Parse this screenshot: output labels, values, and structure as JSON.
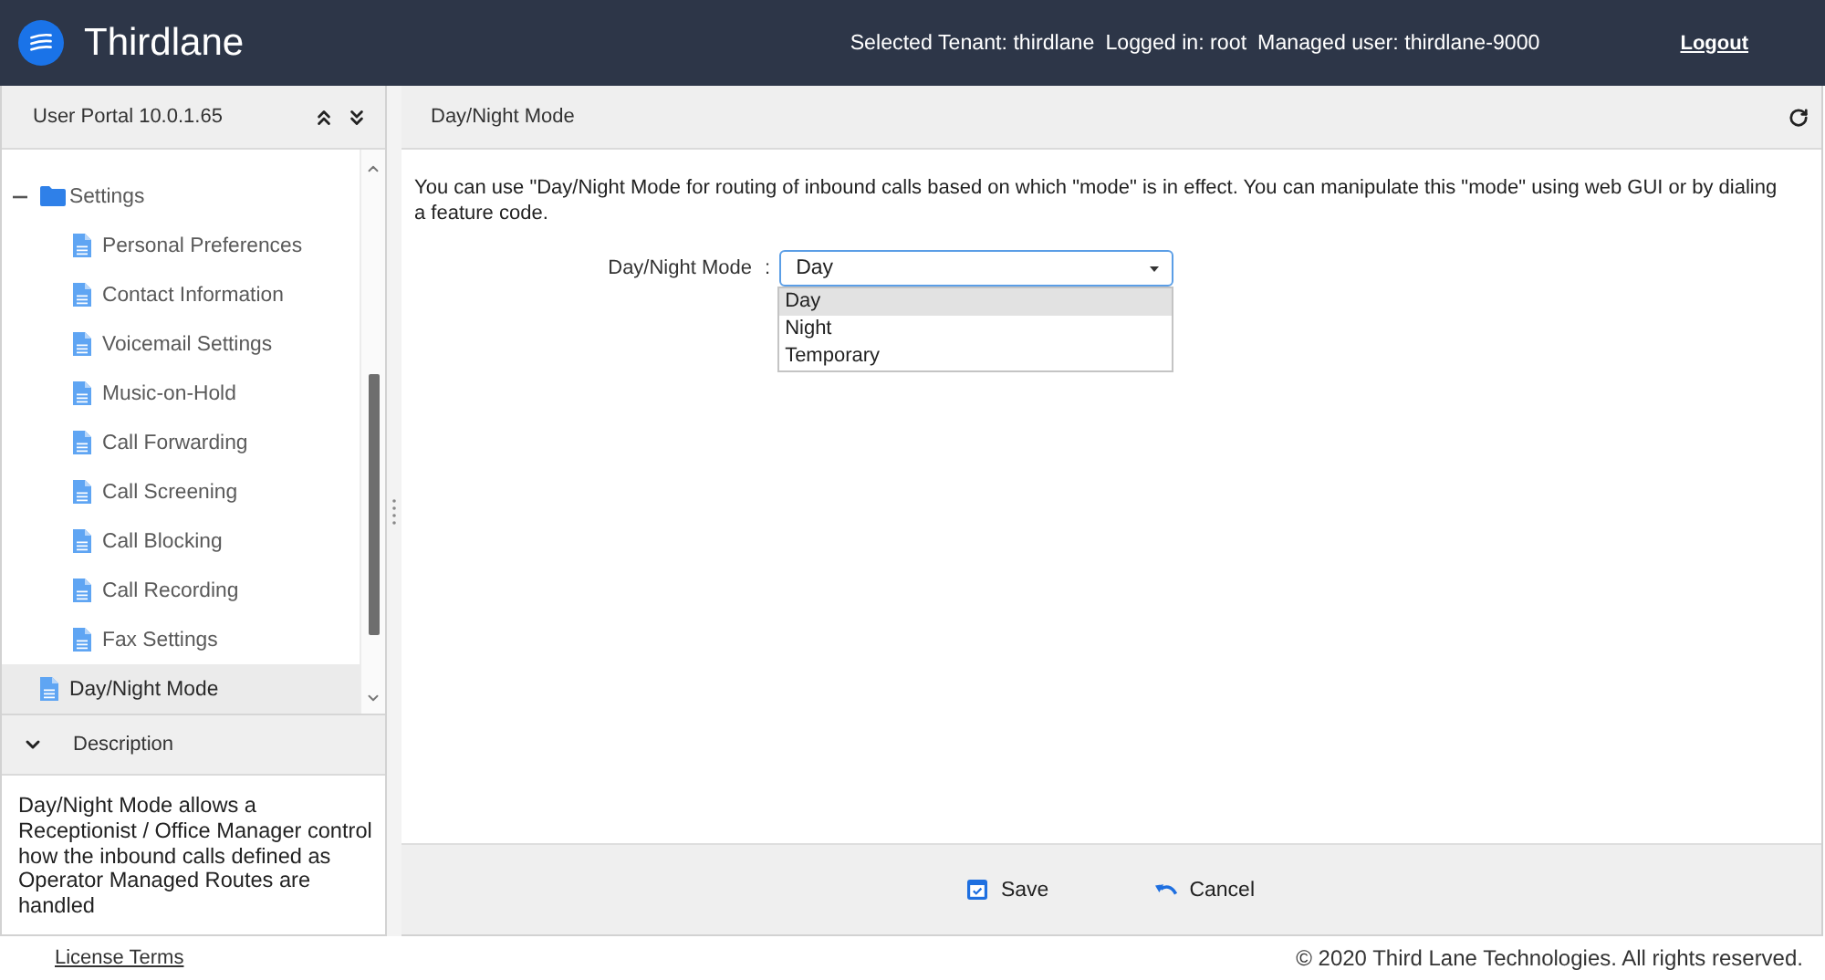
{
  "header": {
    "brand": "Thirdlane",
    "session": [
      "Selected Tenant: thirdlane",
      "Logged in: root",
      "Managed user: thirdlane-9000"
    ],
    "logout": "Logout"
  },
  "sidebar": {
    "title": "User Portal 10.0.1.65",
    "tree": [
      {
        "label": "Settings",
        "kind": "folder",
        "expanded": true,
        "selected": false,
        "children": [
          {
            "label": "Personal Preferences",
            "kind": "document",
            "selected": false
          },
          {
            "label": "Contact Information",
            "kind": "document",
            "selected": false
          },
          {
            "label": "Voicemail Settings",
            "kind": "document",
            "selected": false
          },
          {
            "label": "Music-on-Hold",
            "kind": "document",
            "selected": false
          },
          {
            "label": "Call Forwarding",
            "kind": "document",
            "selected": false
          },
          {
            "label": "Call Screening",
            "kind": "document",
            "selected": false
          },
          {
            "label": "Call Blocking",
            "kind": "document",
            "selected": false
          },
          {
            "label": "Call Recording",
            "kind": "document",
            "selected": false
          },
          {
            "label": "Fax Settings",
            "kind": "document",
            "selected": false
          }
        ]
      },
      {
        "label": "Day/Night Mode",
        "kind": "document",
        "selected": true
      }
    ]
  },
  "description": {
    "title": "Description",
    "expanded": true,
    "text": "Day/Night Mode allows a Receptionist / Office Manager control how the inbound calls defined as Operator Managed Routes are handled"
  },
  "content": {
    "title": "Day/Night Mode",
    "intro": "You can use \"Day/Night Mode for routing of inbound calls based on which \"mode\" is in effect. You can manipulate this \"mode\" using web GUI or by dialing a feature code.",
    "field": {
      "label": "Day/Night Mode",
      "separator": ":",
      "value": "Day",
      "open": true,
      "options": [
        {
          "label": "Day",
          "selected": true
        },
        {
          "label": "Night",
          "selected": false
        },
        {
          "label": "Temporary",
          "selected": false
        }
      ]
    }
  },
  "actions": [
    {
      "kind": "save",
      "label": "Save"
    },
    {
      "kind": "cancel",
      "label": "Cancel"
    }
  ],
  "footer": {
    "link": "License Terms",
    "copyright": "© 2020 Third Lane Technologies. All rights reserved."
  }
}
